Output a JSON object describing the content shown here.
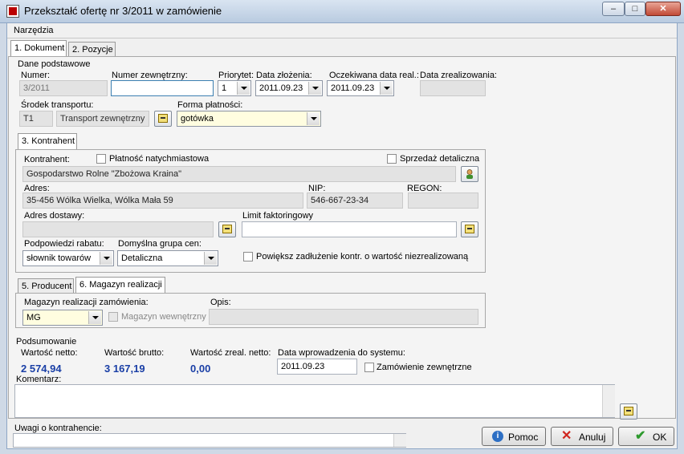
{
  "window": {
    "title": "Przekształć ofertę nr 3/2011 w zamówienie",
    "minimize": "–",
    "maximize": "□",
    "close": "✕"
  },
  "menu": {
    "narzedzia": "Narzędzia"
  },
  "tabs": {
    "dokument": "1. Dokument",
    "pozycje": "2. Pozycje"
  },
  "dane": {
    "group_title": "Dane podstawowe",
    "numer_label": "Numer:",
    "numer_value": "3/2011",
    "numer_zew_label": "Numer zewnętrzny:",
    "numer_zew_value": "",
    "priorytet_label": "Priorytet:",
    "priorytet_value": "1",
    "data_zlozenia_label": "Data złożenia:",
    "data_zlozenia_value": "2011.09.23",
    "oczekiwana_label": "Oczekiwana data real.:",
    "oczekiwana_value": "2011.09.23",
    "data_zreal_label": "Data zrealizowania:",
    "data_zreal_value": "",
    "srodek_label": "Środek transportu:",
    "srodek_code": "T1",
    "srodek_name": "Transport zewnętrzny",
    "forma_label": "Forma płatności:",
    "forma_value": "gotówka"
  },
  "kontrahent": {
    "tab": "3. Kontrahent",
    "label": "Kontrahent:",
    "platnosc_label": "Płatność natychmiastowa",
    "sprzedaz_label": "Sprzedaż detaliczna",
    "name": "Gospodarstwo Rolne \"Zbożowa Kraina\"",
    "adres_label": "Adres:",
    "adres_value": "35-456 Wólka Wielka, Wólka Mała 59",
    "nip_label": "NIP:",
    "nip_value": "546-667-23-34",
    "regon_label": "REGON:",
    "regon_value": "",
    "adres_dostawy_label": "Adres dostawy:",
    "adres_dostawy_value": "",
    "limit_label": "Limit faktoringowy",
    "limit_value": "",
    "podpowiedzi_label": "Podpowiedzi rabatu:",
    "podpowiedzi_value": "słownik towarów",
    "grupa_label": "Domyślna grupa cen:",
    "grupa_value": "Detaliczna",
    "powieksz_label": "Powiększ zadłużenie kontr. o wartość niezrealizowaną"
  },
  "magazyn": {
    "tab_producent": "5. Producent",
    "tab_magazyn": "6. Magazyn realizacji",
    "label": "Magazyn realizacji zamówienia:",
    "value": "MG",
    "wewnetrzny_label": "Magazyn wewnętrzny",
    "opis_label": "Opis:",
    "opis_value": ""
  },
  "podsumowanie": {
    "group_title": "Podsumowanie",
    "netto_label": "Wartość netto:",
    "netto_value": "2 574,94",
    "brutto_label": "Wartość brutto:",
    "brutto_value": "3 167,19",
    "zreal_label": "Wartość zreal. netto:",
    "zreal_value": "0,00",
    "data_wpr_label": "Data wprowadzenia do systemu:",
    "data_wpr_value": "2011.09.23",
    "zam_zew_label": "Zamówienie zewnętrzne",
    "komentarz_label": "Komentarz:",
    "komentarz_value": ""
  },
  "footer": {
    "uwagi_label": "Uwagi o kontrahencie:",
    "uwagi_value": "",
    "pomoc": "Pomoc",
    "anuluj": "Anuluj",
    "ok": "OK"
  },
  "colors": {
    "accent_blue": "#1a3fa6",
    "titlebar": "#c3d4e8",
    "yellow_field": "#fffde0"
  }
}
